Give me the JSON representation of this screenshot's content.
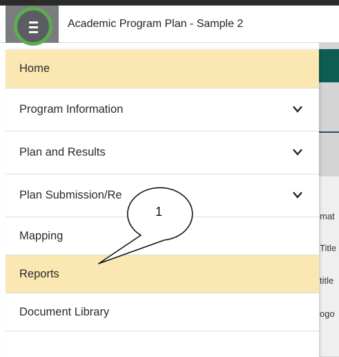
{
  "header": {
    "title": "Academic Program Plan - Sample 2"
  },
  "menu": {
    "items": [
      {
        "label": "Home",
        "active": true,
        "expandable": false
      },
      {
        "label": "Program Information",
        "active": false,
        "expandable": true
      },
      {
        "label": "Plan and Results",
        "active": false,
        "expandable": true
      },
      {
        "label": "Plan Submission/Re",
        "active": false,
        "expandable": true
      },
      {
        "label": "Mapping",
        "active": false,
        "expandable": false
      },
      {
        "label": "Reports",
        "active": true,
        "expandable": false
      },
      {
        "label": "Document Library",
        "active": false,
        "expandable": false
      }
    ]
  },
  "background": {
    "text1": "mat",
    "text2": "Title",
    "text3": "title",
    "text4": "ogo"
  },
  "callout": {
    "number": "1"
  },
  "colors": {
    "highlight": "#fbe7b2",
    "ring": "#5fab4f",
    "menu_button": "#7a7d80",
    "bg_green": "#0d5d52"
  }
}
